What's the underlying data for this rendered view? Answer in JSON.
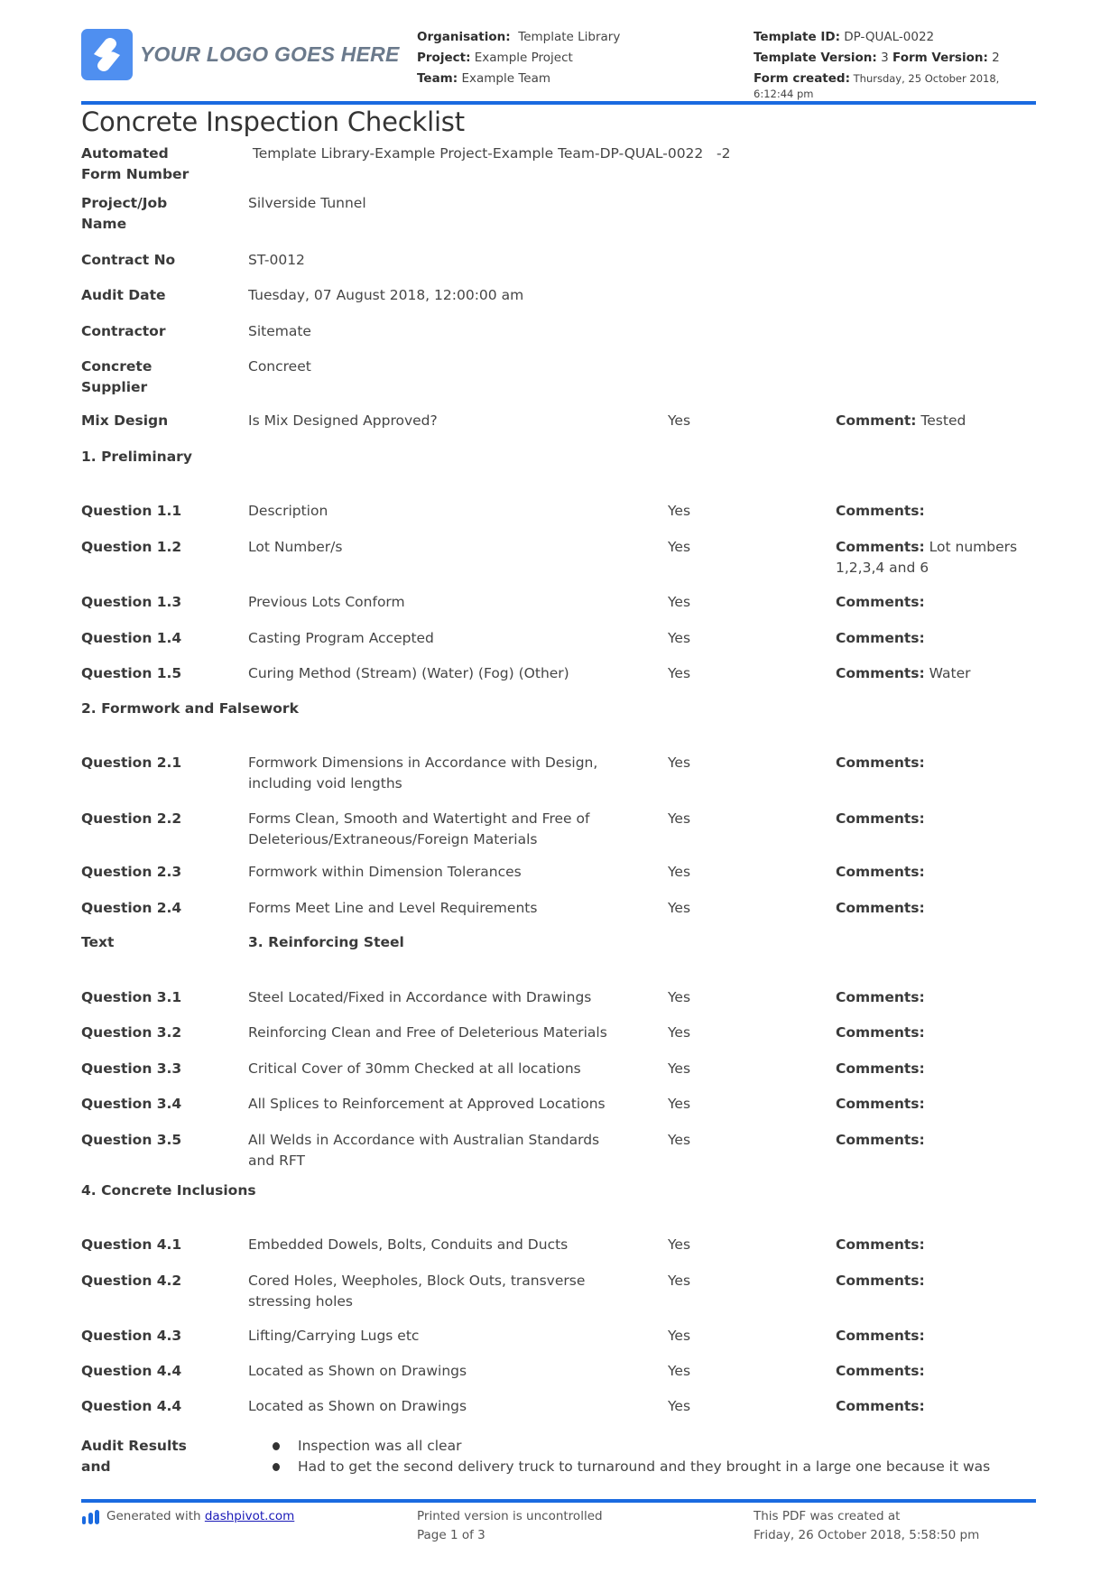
{
  "header": {
    "logo_text": "YOUR LOGO GOES HERE",
    "organisation_label": "Organisation:",
    "organisation_value": "Template Library",
    "project_label": "Project:",
    "project_value": "Example Project",
    "team_label": "Team:",
    "team_value": "Example Team",
    "template_id_label": "Template ID:",
    "template_id_value": "DP-QUAL-0022",
    "template_version_label": "Template Version:",
    "template_version_value": "3",
    "form_version_label": "Form Version:",
    "form_version_value": "2",
    "form_created_label": "Form created:",
    "form_created_value": "Thursday, 25 October 2018, 6:12:44 pm"
  },
  "title": "Concrete Inspection Checklist",
  "fields": [
    {
      "label": "Automated Form Number",
      "value": " Template Library-Example Project-Example Team-DP-QUAL-0022   -2"
    },
    {
      "label": "Project/Job Name",
      "value": "Silverside Tunnel"
    },
    {
      "label": "Contract No",
      "value": "ST-0012"
    },
    {
      "label": "Audit Date",
      "value": "Tuesday, 07 August 2018, 12:00:00 am"
    },
    {
      "label": "Contractor",
      "value": "Sitemate"
    },
    {
      "label": "Concrete Supplier",
      "value": "Concreet"
    }
  ],
  "mix_design": {
    "label": "Mix Design",
    "question": "Is Mix Designed Approved?",
    "answer": "Yes",
    "comment_label": "Comment:",
    "comment": "Tested"
  },
  "sections": [
    {
      "title": "1. Preliminary",
      "prefix": "",
      "questions": [
        {
          "label": "Question 1.1",
          "text": "Description",
          "answer": "Yes",
          "comment_label": "Comments:",
          "comment": ""
        },
        {
          "label": "Question 1.2",
          "text": "Lot Number/s",
          "answer": "Yes",
          "comment_label": "Comments:",
          "comment": "Lot numbers 1,2,3,4 and 6"
        },
        {
          "label": "Question 1.3",
          "text": "Previous Lots Conform",
          "answer": "Yes",
          "comment_label": "Comments:",
          "comment": ""
        },
        {
          "label": "Question 1.4",
          "text": "Casting Program Accepted",
          "answer": "Yes",
          "comment_label": "Comments:",
          "comment": ""
        },
        {
          "label": "Question 1.5",
          "text": "Curing Method (Stream) (Water) (Fog) (Other)",
          "answer": "Yes",
          "comment_label": "Comments:",
          "comment": "Water"
        }
      ]
    },
    {
      "title": "2. Formwork and Falsework",
      "prefix": "",
      "questions": [
        {
          "label": "Question 2.1",
          "text": "Formwork Dimensions in Accordance with Design, including void lengths",
          "answer": "Yes",
          "comment_label": "Comments:",
          "comment": ""
        },
        {
          "label": "Question 2.2",
          "text": "Forms Clean, Smooth and Watertight and Free of Deleterious/Extraneous/Foreign Materials",
          "answer": "Yes",
          "comment_label": "Comments:",
          "comment": ""
        },
        {
          "label": "Question 2.3",
          "text": "Formwork within Dimension Tolerances",
          "answer": "Yes",
          "comment_label": "Comments:",
          "comment": ""
        },
        {
          "label": "Question 2.4",
          "text": "Forms Meet Line and Level Requirements",
          "answer": "Yes",
          "comment_label": "Comments:",
          "comment": ""
        }
      ]
    },
    {
      "title": "3. Reinforcing Steel",
      "prefix": "Text",
      "questions": [
        {
          "label": "Question 3.1",
          "text": "Steel Located/Fixed in Accordance with Drawings",
          "answer": "Yes",
          "comment_label": "Comments:",
          "comment": ""
        },
        {
          "label": "Question 3.2",
          "text": "Reinforcing Clean and Free of Deleterious Materials",
          "answer": "Yes",
          "comment_label": "Comments:",
          "comment": ""
        },
        {
          "label": "Question 3.3",
          "text": "Critical Cover of 30mm Checked at all locations",
          "answer": "Yes",
          "comment_label": "Comments:",
          "comment": ""
        },
        {
          "label": "Question 3.4",
          "text": "All Splices to Reinforcement at Approved Locations",
          "answer": "Yes",
          "comment_label": "Comments:",
          "comment": ""
        },
        {
          "label": "Question 3.5",
          "text": "All Welds in Accordance with Australian Standards and RFT",
          "answer": "Yes",
          "comment_label": "Comments:",
          "comment": ""
        }
      ]
    },
    {
      "title": "4. Concrete Inclusions",
      "prefix": "",
      "questions": [
        {
          "label": "Question 4.1",
          "text": "Embedded Dowels, Bolts, Conduits and Ducts",
          "answer": "Yes",
          "comment_label": "Comments:",
          "comment": ""
        },
        {
          "label": "Question 4.2",
          "text": "Cored Holes, Weepholes, Block Outs, transverse stressing holes",
          "answer": "Yes",
          "comment_label": "Comments:",
          "comment": ""
        },
        {
          "label": "Question 4.3",
          "text": "Lifting/Carrying Lugs etc",
          "answer": "Yes",
          "comment_label": "Comments:",
          "comment": ""
        },
        {
          "label": "Question 4.4",
          "text": "Located as Shown on Drawings",
          "answer": "Yes",
          "comment_label": "Comments:",
          "comment": ""
        },
        {
          "label": "Question 4.4",
          "text": "Located as Shown on Drawings",
          "answer": "Yes",
          "comment_label": "Comments:",
          "comment": ""
        }
      ]
    }
  ],
  "audit_results": {
    "label": "Audit Results and",
    "items": [
      "Inspection was all clear",
      "Had to get the second delivery truck to turnaround and they brought in a large one because it was"
    ]
  },
  "footer": {
    "generated_text": "Generated with",
    "generated_link": "dashpivot.com",
    "uncontrolled": "Printed version is uncontrolled",
    "page": "Page 1 of 3",
    "pdf_created_label": "This PDF was created at",
    "pdf_created_value": "Friday, 26 October 2018, 5:58:50 pm"
  },
  "colors": {
    "accent": "#1a6ae0",
    "logo": "#4f8ff0"
  }
}
